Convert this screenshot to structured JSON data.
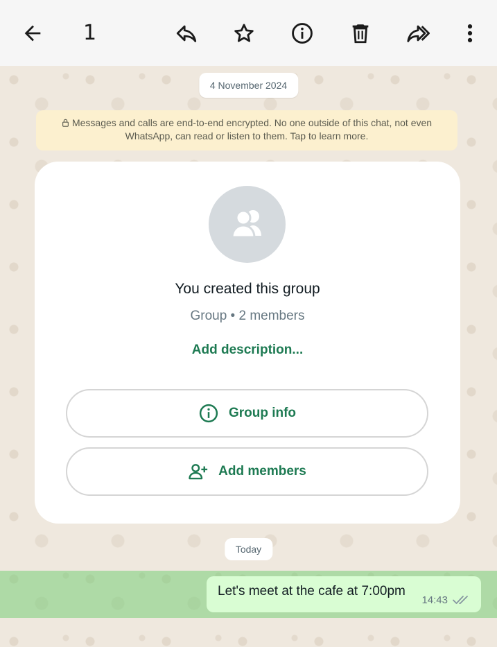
{
  "toolbar": {
    "selected_count": "1",
    "icons": [
      "back-arrow-icon",
      "reply-icon",
      "star-icon",
      "info-icon",
      "delete-icon",
      "forward-icon",
      "more-vert-icon"
    ]
  },
  "chat": {
    "date_label": "4 November 2024",
    "encryption_notice": "Messages and calls are end-to-end encrypted. No one outside of this chat, not even WhatsApp, can read or listen to them. Tap to learn more.",
    "group_card": {
      "title": "You created this group",
      "subtitle": "Group • 2 members",
      "add_description": "Add description...",
      "group_info_label": "Group info",
      "add_members_label": "Add members"
    },
    "today_label": "Today",
    "message": {
      "text": "Let's meet at the cafe at 7:00pm",
      "time": "14:43",
      "status": "read-double-check"
    }
  },
  "colors": {
    "accent": "#1d7a52",
    "bubble_out": "#d9fdd3",
    "selection": "#78cd78",
    "notice_bg": "#fcf0cf"
  }
}
